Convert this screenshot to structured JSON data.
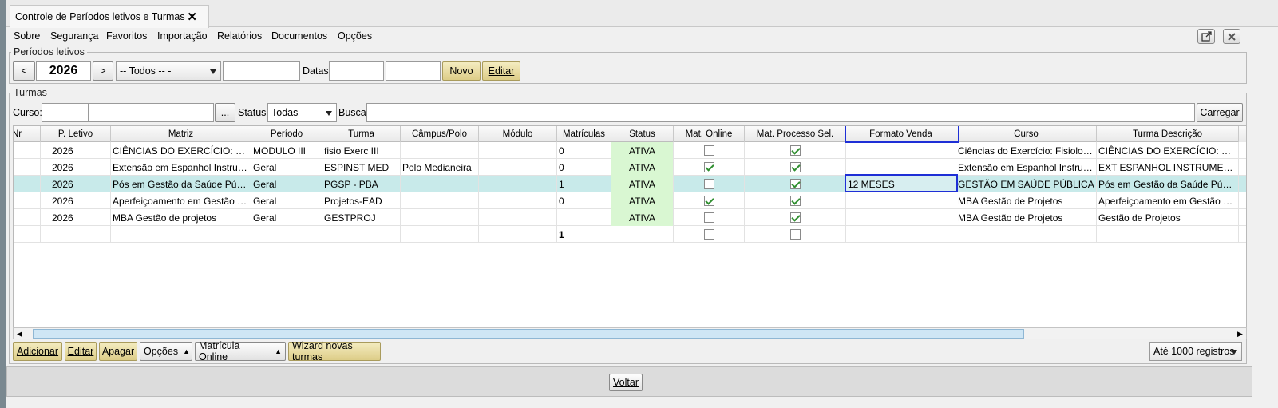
{
  "tab": {
    "title": "Controle de Períodos letivos e Turmas",
    "close": "✕"
  },
  "menu": [
    "Sobre",
    "Segurança",
    "Favoritos",
    "Importação",
    "Relatórios",
    "Documentos",
    "Opções"
  ],
  "periodos": {
    "legend": "Períodos letivos",
    "prev": "<",
    "year": "2026",
    "next": ">",
    "select_value": "-- Todos -- -",
    "datas_label": "Datas:",
    "novo": "Novo",
    "editar": "Editar"
  },
  "turmas": {
    "legend": "Turmas",
    "curso_label": "Curso:",
    "ellipsis": "...",
    "status_label": "Status:",
    "status_value": "Todas",
    "busca_label": "Busca:",
    "carregar": "Carregar"
  },
  "table": {
    "columns": [
      "Nr",
      "P. Letivo",
      "Matriz",
      "Período",
      "Turma",
      "Câmpus/Polo",
      "Módulo",
      "Matrículas",
      "Status",
      "Mat. Online",
      "Mat. Processo Sel.",
      "Formato Venda",
      "Curso",
      "Turma Descrição"
    ],
    "rows": [
      {
        "nr": "",
        "letivo": "2026",
        "matriz": "CIÊNCIAS DO EXERCÍCIO: FISIOLOGIA",
        "periodo": "MODULO III",
        "turma": "fisio Exerc III",
        "campus": "",
        "modulo": "",
        "matriculas": "0",
        "status": "ATIVA",
        "online": false,
        "processo": true,
        "formato": "",
        "curso": "Ciências do Exercício: Fisiologia e Treinamento",
        "descricao": "CIÊNCIAS DO EXERCÍCIO: FISIOLOGIA"
      },
      {
        "nr": "",
        "letivo": "2026",
        "matriz": "Extensão em Espanhol Instrumental",
        "periodo": "Geral",
        "turma": "ESPINST MED",
        "campus": "Polo Medianeira",
        "modulo": "",
        "matriculas": "0",
        "status": "ATIVA",
        "online": true,
        "processo": true,
        "formato": "",
        "curso": "Extensão em Espanhol Instrumental",
        "descricao": "EXT ESPANHOL INSTRUMENTAL"
      },
      {
        "nr": "",
        "letivo": "2026",
        "matriz": "Pós em Gestão da Saúde Pública",
        "periodo": "Geral",
        "turma": "PGSP - PBA",
        "campus": "",
        "modulo": "",
        "matriculas": "1",
        "status": "ATIVA",
        "online": false,
        "processo": true,
        "formato": "12 MESES",
        "curso": "GESTÃO EM SAÚDE PÚBLICA",
        "descricao": "Pós em Gestão da Saúde Pública"
      },
      {
        "nr": "",
        "letivo": "2026",
        "matriz": "Aperfeiçoamento em Gestão de Projetos",
        "periodo": "Geral",
        "turma": "Projetos-EAD",
        "campus": "",
        "modulo": "",
        "matriculas": "0",
        "status": "ATIVA",
        "online": true,
        "processo": true,
        "formato": "",
        "curso": "MBA Gestão de Projetos",
        "descricao": "Aperfeiçoamento em Gestão de Projetos"
      },
      {
        "nr": "",
        "letivo": "2026",
        "matriz": "MBA Gestão de projetos",
        "periodo": "Geral",
        "turma": "GESTPROJ",
        "campus": "",
        "modulo": "",
        "matriculas": "",
        "status": "ATIVA",
        "online": false,
        "processo": true,
        "formato": "",
        "curso": "MBA Gestão de Projetos",
        "descricao": "Gestão de Projetos"
      }
    ],
    "total_matriculas": "1",
    "total_online": false,
    "total_processo": false
  },
  "actions": {
    "adicionar": "Adicionar",
    "editar": "Editar",
    "apagar": "Apagar",
    "opcoes": "Opções",
    "matricula_online": "Matrícula Online",
    "wizard": "Wizard novas turmas",
    "registros": "Até 1000 registros"
  },
  "footer": {
    "voltar": "Voltar"
  },
  "colors": {
    "status_bg": "#d9f7d2",
    "selected_row": "#c8eaea",
    "focus_border": "#1e2fd6",
    "yellow_button": "#e6d99a"
  }
}
